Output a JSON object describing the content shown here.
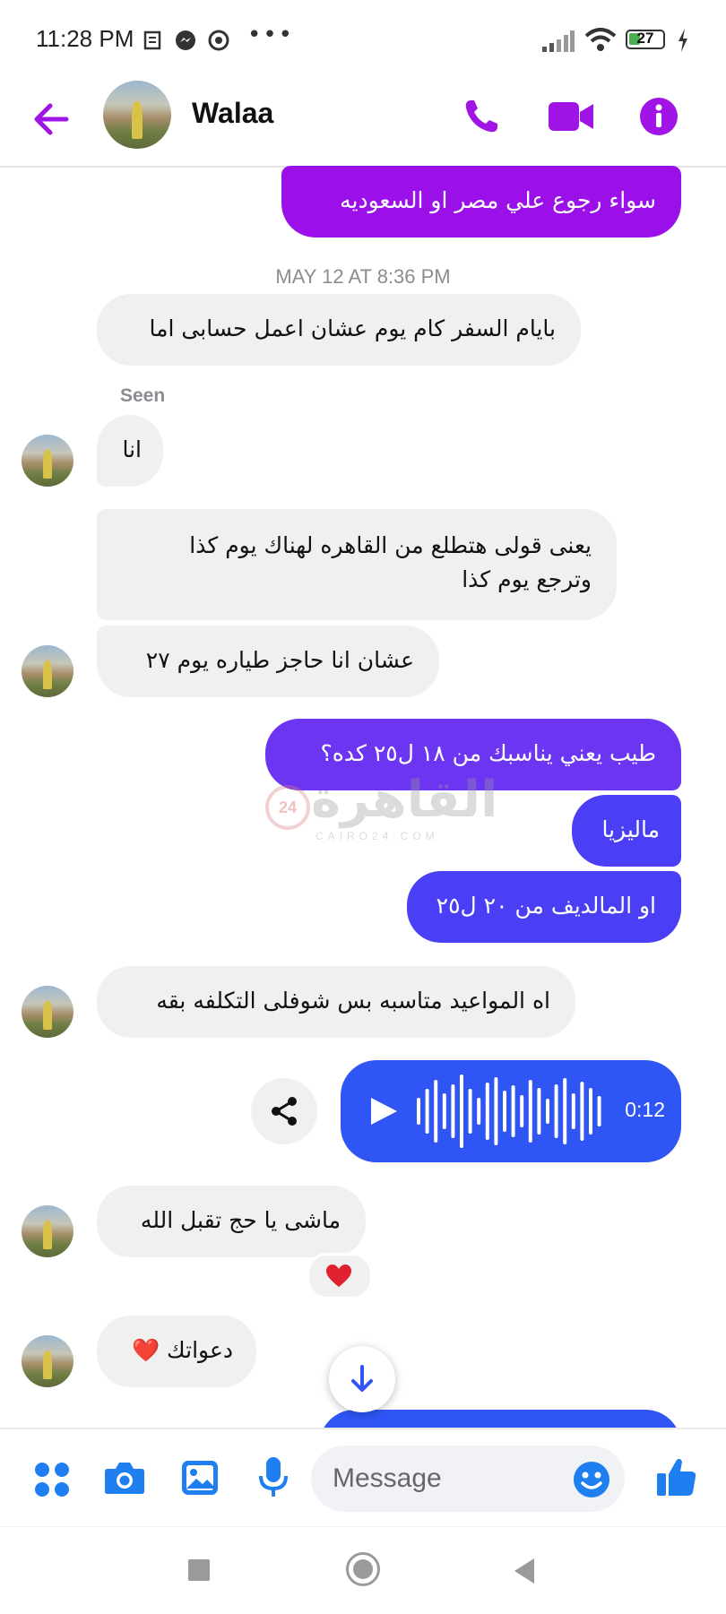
{
  "status_bar": {
    "time": "11:28 PM",
    "battery": "27",
    "icons": [
      "news-icon",
      "messenger-icon",
      "chrome-icon",
      "more-dots-icon",
      "signal-icon",
      "wifi-icon",
      "battery-icon",
      "charging-icon"
    ]
  },
  "header": {
    "contact_name": "Walaa",
    "back_icon": "arrow-left-icon",
    "actions": [
      "phone-icon",
      "video-camera-icon",
      "info-icon"
    ],
    "accent_color": "#a014e6"
  },
  "conversation": {
    "timestamp": "MAY 12 AT 8:36 PM",
    "seen_label": "Seen",
    "messages": [
      {
        "from": "me",
        "text": "سواء رجوع علي مصر او السعوديه"
      },
      {
        "from": "them",
        "text": "بايام السفر كام يوم عشان اعمل حسابى اما"
      },
      {
        "from": "them",
        "text": "انا"
      },
      {
        "from": "them",
        "lines": [
          "يعنى قولى هتطلع من القاهره لهناك يوم كذا",
          "وترجع يوم كذا"
        ]
      },
      {
        "from": "them",
        "text": "عشان انا حاجز طياره يوم ٢٧"
      },
      {
        "from": "me",
        "text": "طيب يعني يناسبك من ١٨ ل٢٥ كده؟"
      },
      {
        "from": "me",
        "text": "ماليزيا"
      },
      {
        "from": "me",
        "text": "او المالديف من ٢٠ ل٢٥"
      },
      {
        "from": "them",
        "text": "اه المواعيد متاسبه بس شوفلى التكلفه بقه"
      },
      {
        "from": "me",
        "type": "voice",
        "duration": "0:12"
      },
      {
        "from": "them",
        "text": "ماشى يا حج تقبل الله",
        "reaction": "heart-emoji"
      },
      {
        "from": "them",
        "text": "دعواتك ❤️"
      }
    ]
  },
  "watermark": {
    "text": "القاهرة",
    "badge": "24",
    "sub": "CAIRO24.COM"
  },
  "composer": {
    "placeholder": "Message",
    "icons": [
      "apps-grid-icon",
      "camera-icon",
      "gallery-icon",
      "microphone-icon",
      "emoji-icon",
      "thumbs-up-icon"
    ]
  },
  "nav_bar": {
    "icons": [
      "recents-square-icon",
      "home-circle-icon",
      "back-triangle-icon"
    ]
  }
}
